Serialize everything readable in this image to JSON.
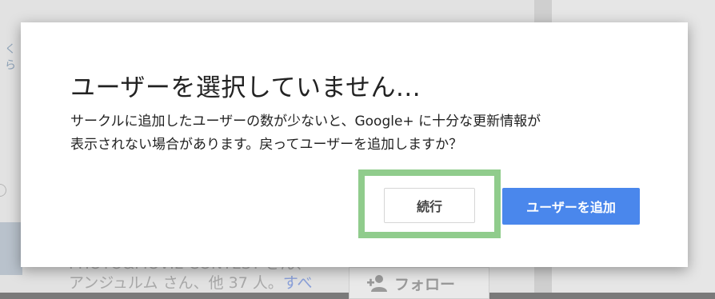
{
  "background": {
    "logo_glyphs": "くら",
    "list_text_line1": "PHOTO&MOVIE CONTEST さん、",
    "list_text_line2": "アンジュルム さん、他 37 人。",
    "list_text_link": "すべ",
    "follow_label": "フォロー",
    "follow_icon": "add-person-icon"
  },
  "dialog": {
    "title": "ユーザーを選択していません...",
    "body": "サークルに追加したユーザーの数が少ないと、Google+ に十分な更新情報が\n表示されない場合があります。戻ってユーザーを追加しますか？",
    "continue_label": "続行",
    "add_users_label": "ユーザーを追加",
    "highlight_color": "#90cc8c",
    "primary_color": "#4a87ec"
  }
}
